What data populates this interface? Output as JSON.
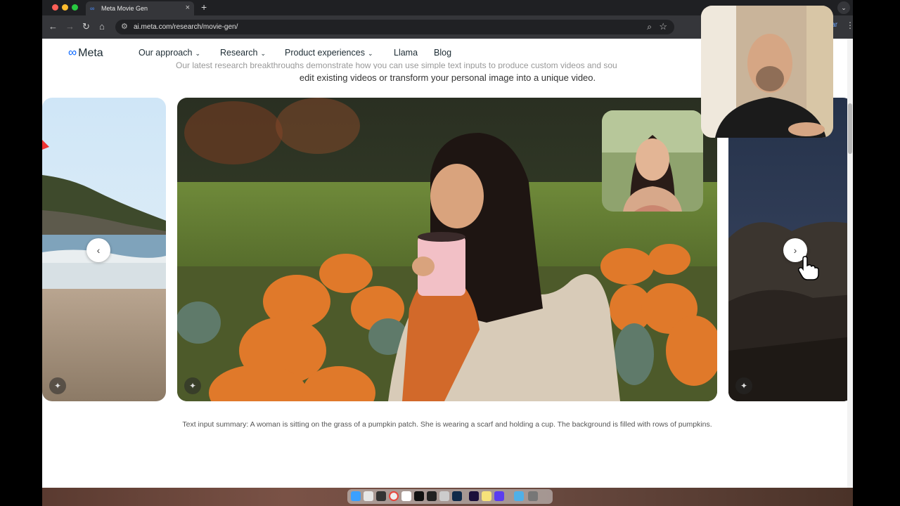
{
  "browser": {
    "tab": {
      "title": "Meta Movie Gen",
      "favicon": "meta-favicon-icon",
      "close": "×"
    },
    "new_tab": "+",
    "tab_menu": "⌄",
    "address": "ai.meta.com/research/movie-gen/",
    "profile_label": "izar"
  },
  "nav": {
    "logo": "Meta",
    "items": [
      {
        "label": "Our approach",
        "has_dropdown": true
      },
      {
        "label": "Research",
        "has_dropdown": true
      },
      {
        "label": "Product experiences",
        "has_dropdown": true
      },
      {
        "label": "Llama",
        "has_dropdown": false
      },
      {
        "label": "Blog",
        "has_dropdown": false
      }
    ]
  },
  "content": {
    "intro_line_partial": "Our latest research breakthroughs demonstrate how you can use simple text inputs to produce custom videos and sou",
    "intro_line2": "edit existing videos or transform your personal image into a unique video.",
    "caption": "Text input summary: A woman is sitting on the grass of a pumpkin patch. She is wearing a scarf and holding a cup. The background is filled with rows of pumpkins.",
    "prev_arrow": "‹",
    "next_arrow": "›"
  },
  "icons": {
    "sparkle": "✦",
    "back": "←",
    "forward": "→",
    "reload": "↻",
    "home": "⌂",
    "zoom": "⌕",
    "bookmark": "☆",
    "menu": "⋮"
  },
  "colors": {
    "brand_blue": "#0866ff",
    "browser_dark": "#35363a",
    "tabbar": "#1f2023"
  }
}
